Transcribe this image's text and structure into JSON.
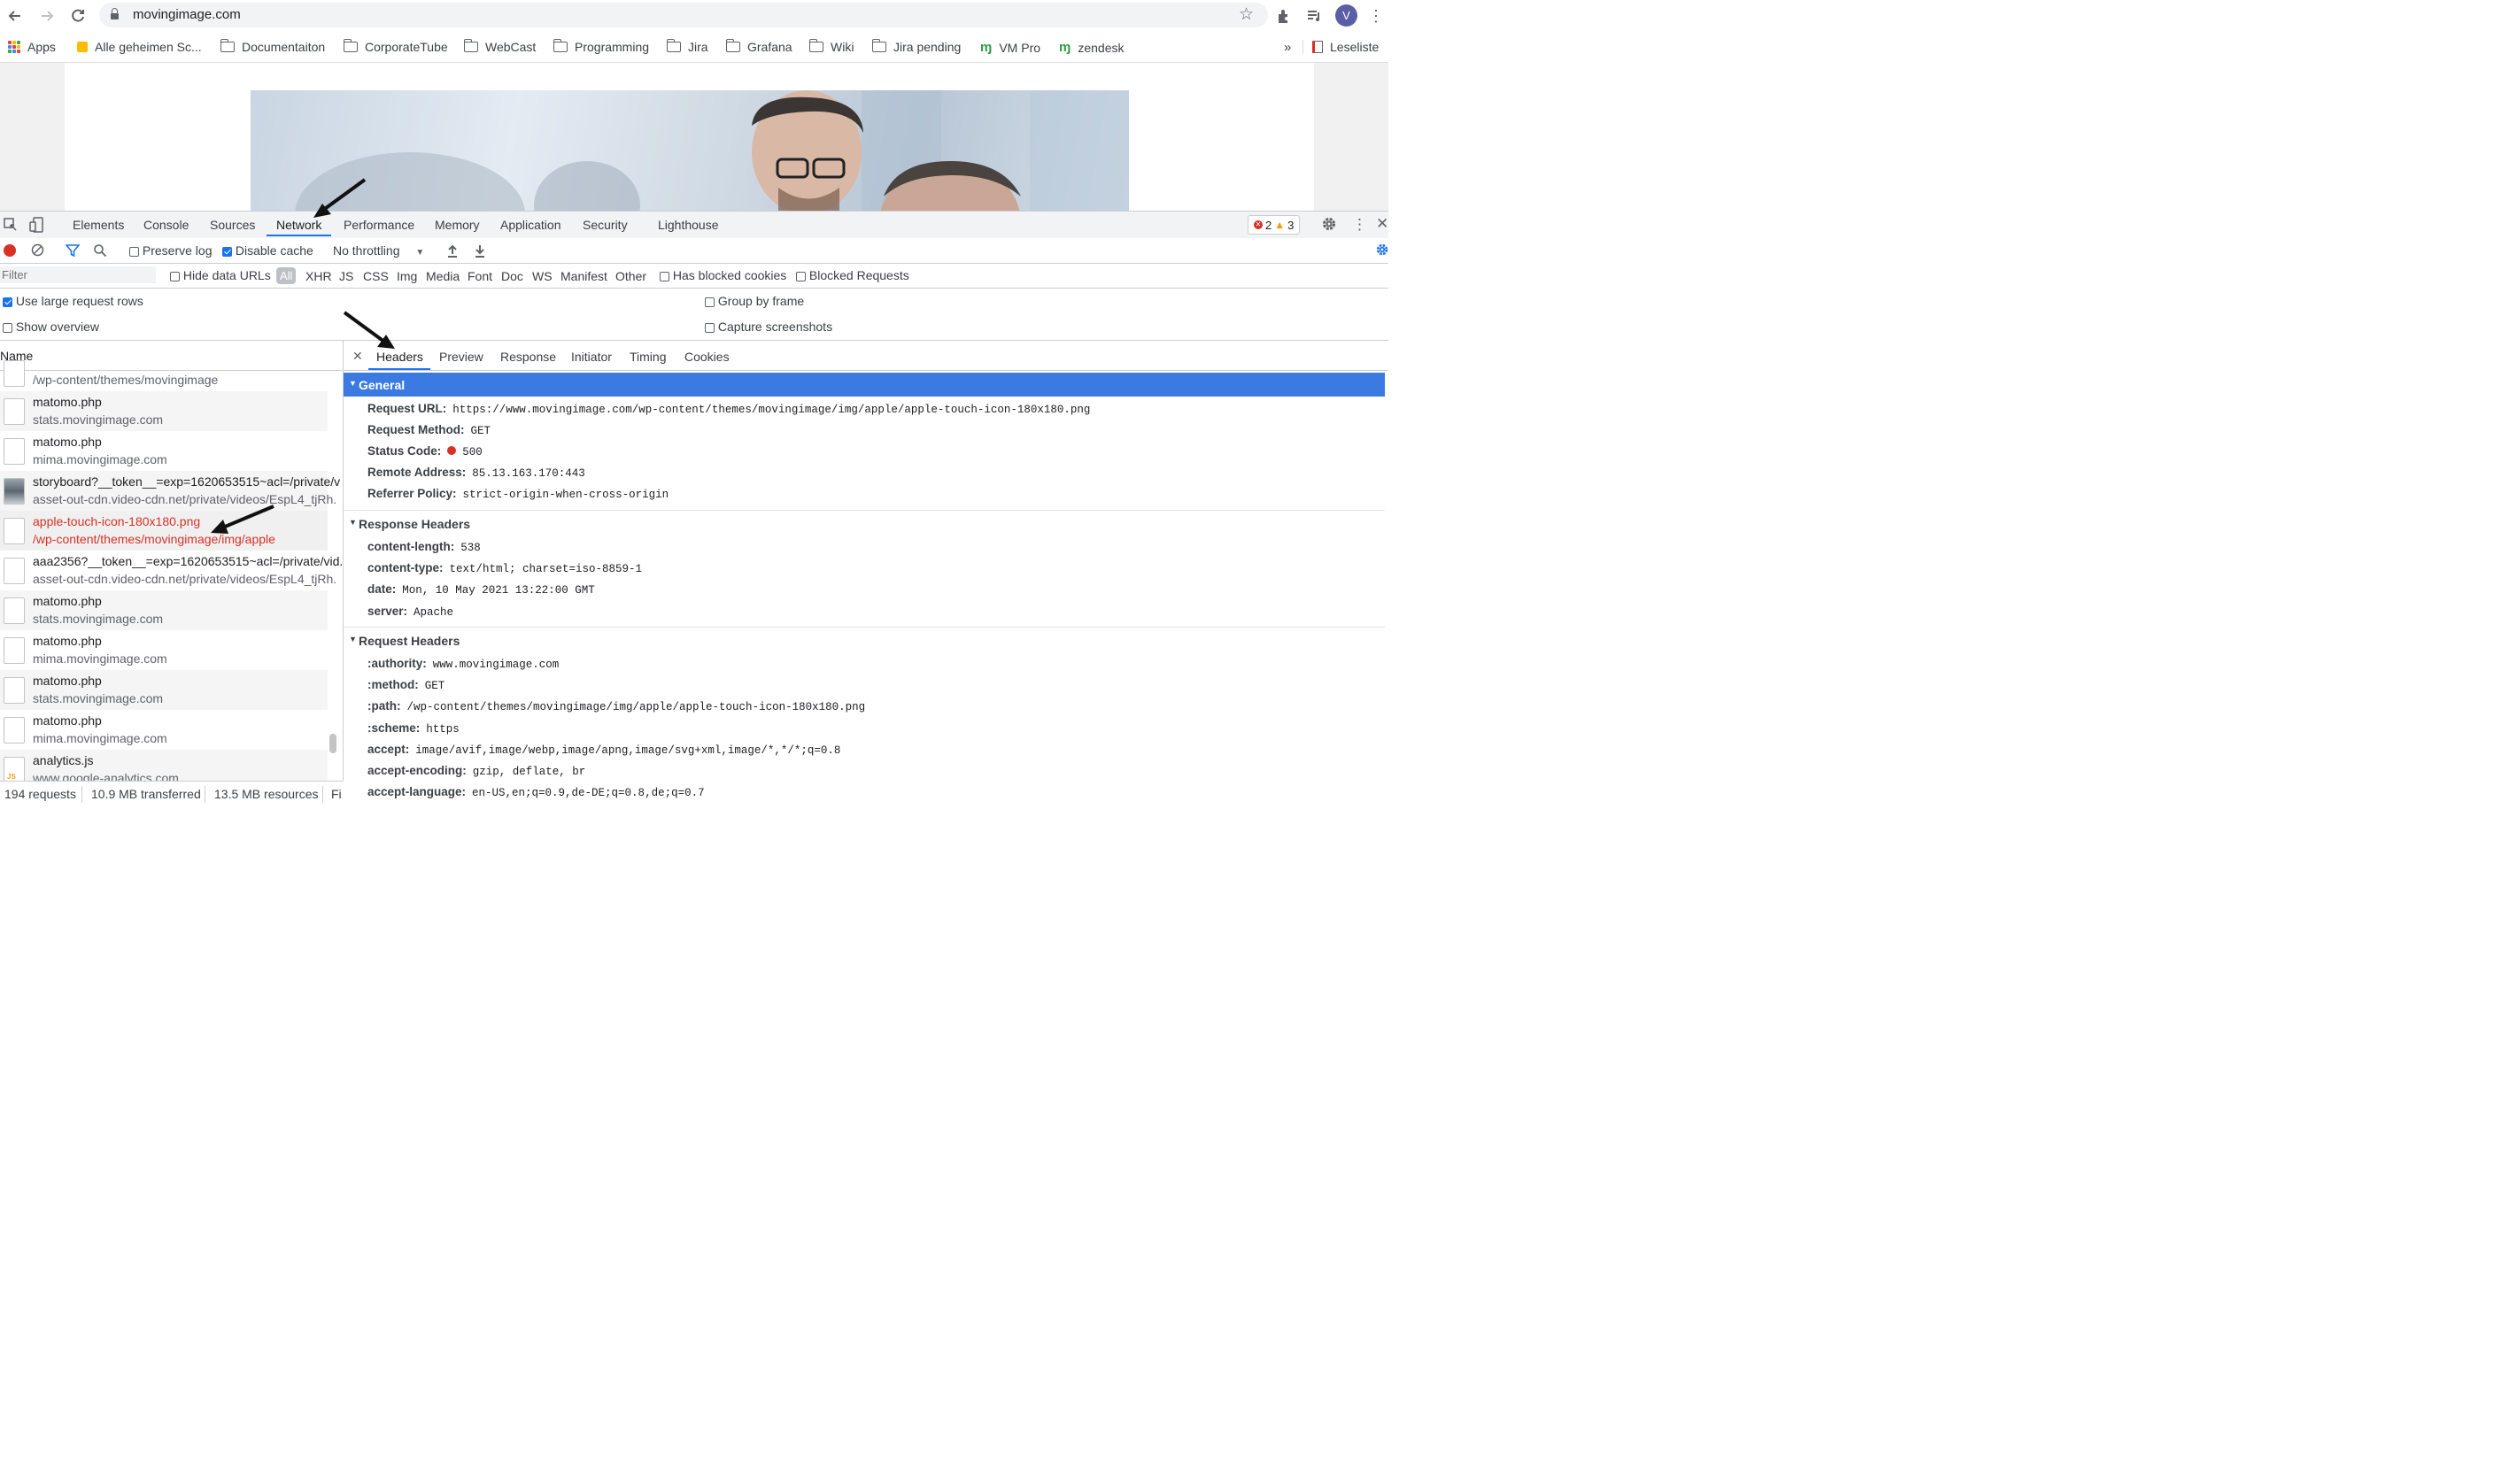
{
  "browser": {
    "url": "movingimage.com",
    "bookmarks": [
      "Apps",
      "Alle geheimen Sc...",
      "Documentaiton",
      "CorporateTube",
      "WebCast",
      "Programming",
      "Jira",
      "Grafana",
      "Wiki",
      "Jira pending",
      "VM Pro",
      "zendesk"
    ],
    "reading_list": "Leseliste",
    "overflow": "»",
    "profile_initial": "V"
  },
  "devtools": {
    "tabs": [
      "Elements",
      "Console",
      "Sources",
      "Network",
      "Performance",
      "Memory",
      "Application",
      "Security",
      "Lighthouse"
    ],
    "active_tab": "Network",
    "error_count": "2",
    "warning_count": "3",
    "toolbar": {
      "preserve_log": "Preserve log",
      "disable_cache": "Disable cache",
      "throttling": "No throttling"
    },
    "filter": {
      "placeholder": "Filter",
      "hide_data_urls": "Hide data URLs",
      "types": [
        "All",
        "XHR",
        "JS",
        "CSS",
        "Img",
        "Media",
        "Font",
        "Doc",
        "WS",
        "Manifest",
        "Other"
      ],
      "has_blocked_cookies": "Has blocked cookies",
      "blocked_requests": "Blocked Requests"
    },
    "settings": {
      "use_large_rows": "Use large request rows",
      "show_overview": "Show overview",
      "group_by_frame": "Group by frame",
      "capture_screenshots": "Capture screenshots"
    },
    "requests_header": "Name",
    "requests": [
      {
        "name": "",
        "sub": "/wp-content/themes/movingimage"
      },
      {
        "name": "matomo.php",
        "sub": "stats.movingimage.com"
      },
      {
        "name": "matomo.php",
        "sub": "mima.movingimage.com"
      },
      {
        "name": "storyboard?__token__=exp=1620653515~acl=/private/v",
        "sub": "asset-out-cdn.video-cdn.net/private/videos/EspL4_tjRh."
      },
      {
        "name": "apple-touch-icon-180x180.png",
        "sub": "/wp-content/themes/movingimage/img/apple"
      },
      {
        "name": "aaa2356?__token__=exp=1620653515~acl=/private/vid.",
        "sub": "asset-out-cdn.video-cdn.net/private/videos/EspL4_tjRh."
      },
      {
        "name": "matomo.php",
        "sub": "stats.movingimage.com"
      },
      {
        "name": "matomo.php",
        "sub": "mima.movingimage.com"
      },
      {
        "name": "matomo.php",
        "sub": "stats.movingimage.com"
      },
      {
        "name": "matomo.php",
        "sub": "mima.movingimage.com"
      },
      {
        "name": "analytics.js",
        "sub": "www.google-analytics.com"
      }
    ],
    "status": {
      "requests": "194 requests",
      "transferred": "10.9 MB transferred",
      "resources": "13.5 MB resources",
      "finish": "Fi"
    },
    "detail_tabs": [
      "Headers",
      "Preview",
      "Response",
      "Initiator",
      "Timing",
      "Cookies"
    ],
    "general": {
      "title": "General",
      "rows": [
        {
          "k": "Request URL:",
          "v": "https://www.movingimage.com/wp-content/themes/movingimage/img/apple/apple-touch-icon-180x180.png"
        },
        {
          "k": "Request Method:",
          "v": "GET"
        },
        {
          "k": "Status Code:",
          "v": "500"
        },
        {
          "k": "Remote Address:",
          "v": "85.13.163.170:443"
        },
        {
          "k": "Referrer Policy:",
          "v": "strict-origin-when-cross-origin"
        }
      ]
    },
    "response_headers": {
      "title": "Response Headers",
      "rows": [
        {
          "k": "content-length:",
          "v": "538"
        },
        {
          "k": "content-type:",
          "v": "text/html; charset=iso-8859-1"
        },
        {
          "k": "date:",
          "v": "Mon, 10 May 2021 13:22:00 GMT"
        },
        {
          "k": "server:",
          "v": "Apache"
        }
      ]
    },
    "request_headers": {
      "title": "Request Headers",
      "rows": [
        {
          "k": ":authority:",
          "v": "www.movingimage.com"
        },
        {
          "k": ":method:",
          "v": "GET"
        },
        {
          "k": ":path:",
          "v": "/wp-content/themes/movingimage/img/apple/apple-touch-icon-180x180.png"
        },
        {
          "k": ":scheme:",
          "v": "https"
        },
        {
          "k": "accept:",
          "v": "image/avif,image/webp,image/apng,image/svg+xml,image/*,*/*;q=0.8"
        },
        {
          "k": "accept-encoding:",
          "v": "gzip, deflate, br"
        },
        {
          "k": "accept-language:",
          "v": "en-US,en;q=0.9,de-DE;q=0.8,de;q=0.7"
        }
      ]
    }
  },
  "colors": {
    "accent": "#1a73e8",
    "section_header": "#3b7ae1",
    "error_text": "#d93025",
    "record": "#d93025"
  },
  "icons": [
    "back-icon",
    "forward-icon",
    "reload-icon",
    "lock-icon",
    "star-icon",
    "extensions-icon",
    "media-icon",
    "more-icon",
    "record-icon",
    "clear-icon",
    "filter-icon",
    "search-icon",
    "upload-icon",
    "download-icon",
    "gear-icon",
    "close-icon",
    "inspect-icon",
    "device-icon"
  ]
}
